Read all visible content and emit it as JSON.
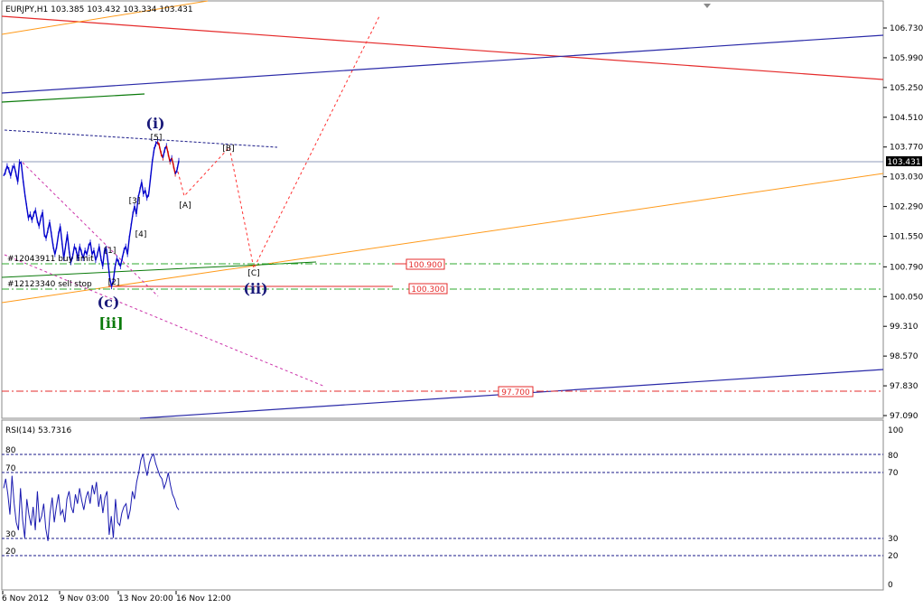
{
  "chart_data": {
    "type": "line",
    "symbol_header": "EURJPY,H1  103.385 103.432 103.334 103.431",
    "current_price": "103.431",
    "price_axis": {
      "ticks": [
        "106.730",
        "105.990",
        "105.250",
        "104.510",
        "103.770",
        "103.030",
        "102.290",
        "101.550",
        "100.790",
        "100.050",
        "99.310",
        "98.570",
        "97.830",
        "97.090"
      ],
      "ylim": [
        97.09,
        107.02
      ]
    },
    "time_axis": {
      "labels": [
        "6 Nov 2012",
        "9 Nov 03:00",
        "13 Nov 20:00",
        "16 Nov 12:00"
      ]
    },
    "price_closes": [
      103.05,
      103.15,
      103.3,
      103.2,
      103.05,
      103.25,
      103.3,
      103.1,
      102.9,
      103.4,
      103.35,
      102.95,
      102.6,
      102.3,
      102.0,
      102.1,
      101.95,
      102.1,
      102.2,
      101.95,
      101.8,
      102.0,
      102.15,
      101.6,
      101.5,
      101.7,
      101.9,
      101.6,
      101.3,
      101.1,
      101.3,
      101.6,
      101.8,
      101.4,
      101.0,
      101.3,
      101.6,
      101.2,
      100.9,
      101.05,
      101.3,
      101.2,
      101.0,
      101.3,
      101.15,
      101.0,
      101.2,
      101.1,
      101.3,
      101.4,
      101.1,
      101.2,
      100.95,
      101.1,
      101.3,
      101.0,
      100.8,
      101.2,
      101.25,
      100.9,
      100.5,
      100.3,
      100.45,
      100.8,
      101.0,
      100.9,
      100.8,
      101.0,
      101.2,
      101.3,
      101.1,
      101.5,
      101.8,
      102.1,
      102.3,
      102.1,
      102.5,
      102.7,
      102.9,
      102.6,
      102.7,
      102.5,
      102.6,
      103.0,
      103.4,
      103.7,
      103.85,
      103.9,
      103.8,
      103.6,
      103.5,
      103.7,
      103.8,
      103.6,
      103.4,
      103.5,
      103.3,
      103.1,
      103.2,
      103.431
    ],
    "levels": [
      {
        "label": "100.900",
        "value": 100.9
      },
      {
        "label": "100.300",
        "value": 100.3
      },
      {
        "label": "97.700",
        "value": 97.7
      }
    ],
    "orders": [
      {
        "label": "#12043911 buy limit"
      },
      {
        "label": "#12123340 sell stop"
      }
    ],
    "wave_labels": {
      "major": [
        "(i)",
        "(c)",
        "[ii]",
        "(ii)"
      ],
      "minor": [
        "[A]",
        "[B]",
        "[C]",
        "[1]",
        "[2]",
        "[3]",
        "[4]",
        "[5]"
      ]
    },
    "rsi": {
      "header": "RSI(14) 53.7316",
      "levels_left": [
        "80",
        "70",
        "30",
        "20"
      ],
      "levels_right": [
        "100",
        "80",
        "70",
        "30",
        "20",
        "0"
      ],
      "values": [
        62,
        68,
        58,
        45,
        70,
        52,
        40,
        35,
        62,
        42,
        30,
        55,
        45,
        38,
        50,
        35,
        60,
        40,
        44,
        52,
        36,
        28,
        46,
        56,
        40,
        50,
        58,
        45,
        48,
        40,
        55,
        60,
        50,
        46,
        58,
        52,
        62,
        54,
        48,
        56,
        60,
        52,
        64,
        58,
        66,
        50,
        58,
        46,
        56,
        60,
        32,
        44,
        30,
        55,
        40,
        38,
        46,
        50,
        52,
        42,
        48,
        60,
        55,
        66,
        72,
        80,
        84,
        76,
        70,
        78,
        82,
        84,
        78,
        74,
        70,
        68,
        62,
        66,
        72,
        64,
        58,
        55,
        50,
        48
      ]
    },
    "colors": {
      "price_line": "#0000cc",
      "price_down": "#cc0000",
      "red_trend": "#e52b2b",
      "blue_trend": "#2a2aa8",
      "orange_trend": "#ff9a1a",
      "green_trend": "#0a7a0a",
      "projection": "#ff3030",
      "magenta_channel": "#cc33aa"
    }
  }
}
